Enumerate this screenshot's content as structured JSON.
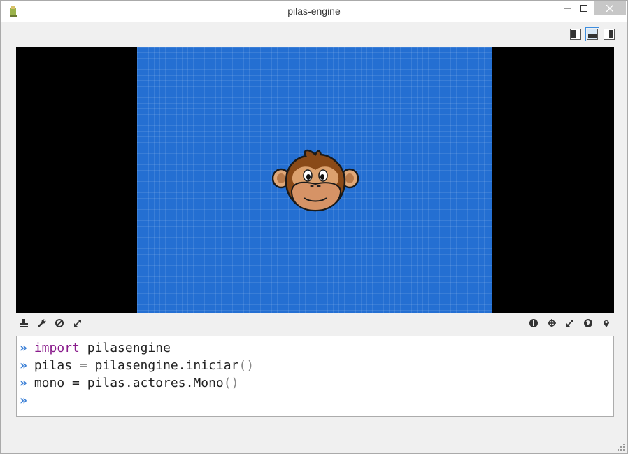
{
  "window": {
    "title": "pilas-engine"
  },
  "layout_buttons": [
    "layout-left-icon",
    "layout-bottom-icon",
    "layout-right-icon"
  ],
  "toolbar_left": [
    "save-icon",
    "wrench-icon",
    "block-icon",
    "resize-icon"
  ],
  "toolbar_right": [
    "info-icon",
    "crosshair-icon",
    "expand-icon",
    "globe-icon",
    "pin-icon"
  ],
  "console": {
    "prompt": "»",
    "lines": [
      {
        "keyword": "import",
        "code": " pilasengine",
        "paren": ""
      },
      {
        "keyword": "",
        "code": "pilas = pilasengine.iniciar",
        "paren": "()"
      },
      {
        "keyword": "",
        "code": "mono = pilas.actores.Mono",
        "paren": "()"
      },
      {
        "keyword": "",
        "code": "",
        "paren": ""
      }
    ]
  },
  "colors": {
    "stage": "#246fd2",
    "prompt": "#3a7fd6",
    "keyword": "#8a1c8c"
  }
}
